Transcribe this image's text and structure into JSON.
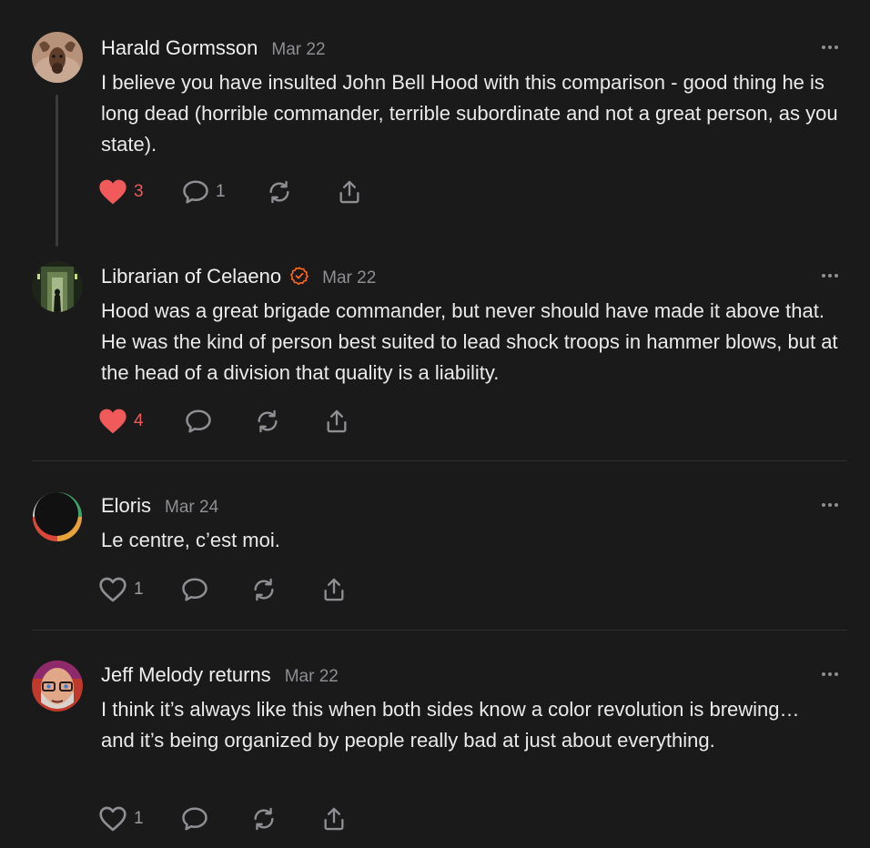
{
  "comments": [
    {
      "author": "Harald Gormsson",
      "date": "Mar 22",
      "verified": false,
      "text": "I believe you have insulted John Bell Hood with this comparison - good thing he is long dead (horrible commander, terrible subordinate and not a great person, as you state).",
      "likes": "3",
      "liked": true,
      "replies": "1",
      "avatar_icon": "moose-avatar"
    },
    {
      "author": "Librarian of Celaeno",
      "date": "Mar 22",
      "verified": true,
      "text": "Hood was a great brigade commander, but never should have made it above that. He was the kind of person best suited to lead shock troops in hammer blows, but at the head of a division that quality is a liability.",
      "likes": "4",
      "liked": true,
      "replies": "",
      "avatar_icon": "corridor-figure-avatar"
    },
    {
      "author": "Eloris",
      "date": "Mar 24",
      "verified": false,
      "text": "Le centre, c’est moi.",
      "likes": "1",
      "liked": false,
      "replies": "",
      "avatar_icon": "eclipse-avatar"
    },
    {
      "author": "Jeff Melody returns",
      "date": "Mar 22",
      "verified": false,
      "text": "I think it’s always like this when both sides know a color revolution is brewing… and it’s being organized by people really bad at just about everything.",
      "likes": "1",
      "liked": false,
      "replies": "",
      "avatar_icon": "bearded-man-avatar"
    }
  ],
  "colors": {
    "background": "#1a1a1b",
    "like_active": "#f05a5a",
    "icon_muted": "#8e8e93",
    "verified_badge": "#ff6719"
  }
}
